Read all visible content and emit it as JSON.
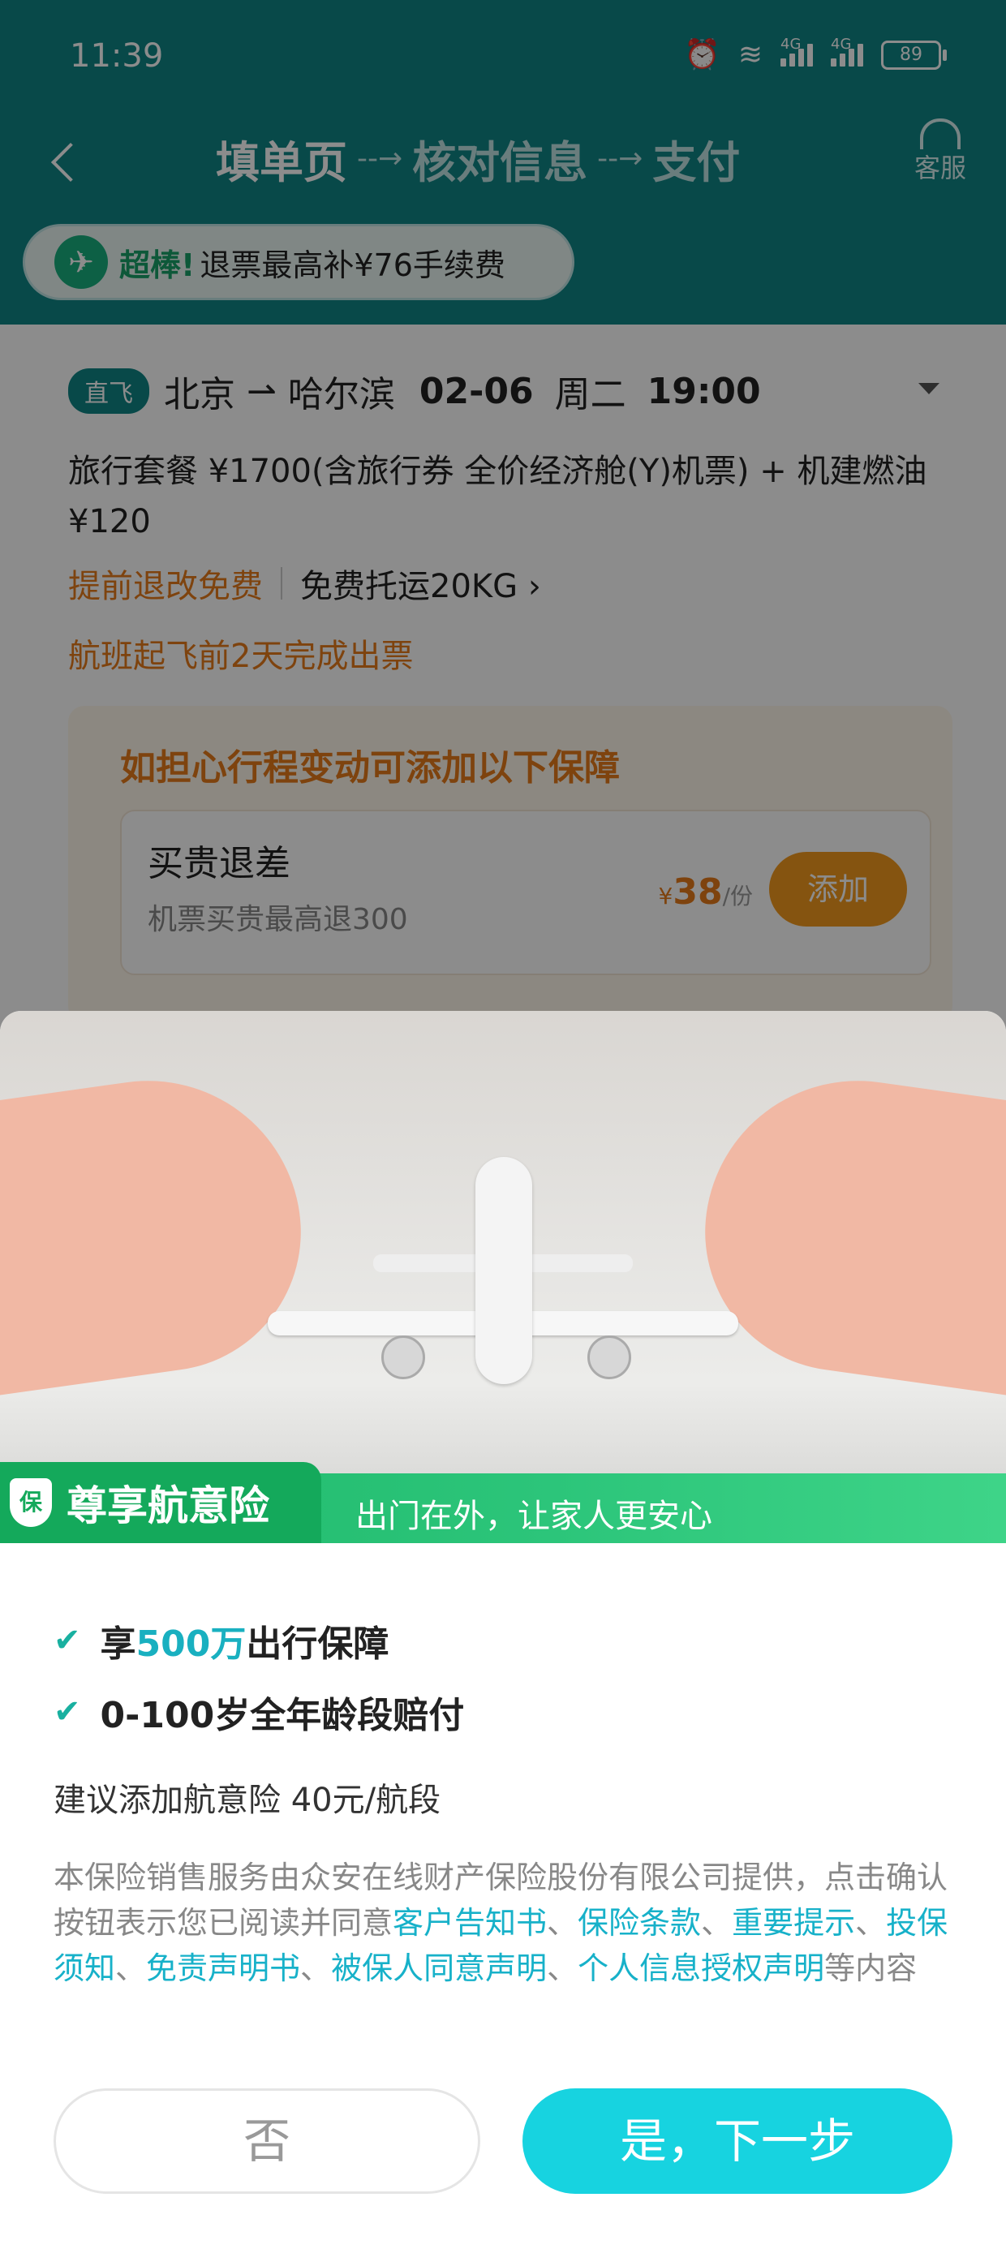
{
  "status_bar": {
    "time": "11:39",
    "battery": "89",
    "network_label": "4G"
  },
  "nav": {
    "steps": [
      "填单页",
      "核对信息",
      "支付"
    ],
    "service_label": "客服"
  },
  "promo": {
    "strong": "超棒!",
    "text": "退票最高补¥76手续费"
  },
  "flight": {
    "badge": "直飞",
    "from": "北京",
    "to": "哈尔滨",
    "date": "02-06",
    "weekday": "周二",
    "time": "19:00",
    "fare_line": "旅行套餐 ¥1700(含旅行券 全价经济舱(Y)机票) + 机建燃油 ¥120",
    "refund_rule": "提前退改免费",
    "baggage": "免费托运20KG ›",
    "ticketing": "航班起飞前2天完成出票"
  },
  "guarantee": {
    "title": "如担心行程变动可添加以下保障",
    "item_name": "买贵退差",
    "item_desc": "机票买贵最高退300",
    "currency": "¥",
    "price": "38",
    "unit": "/份",
    "add_label": "添加"
  },
  "insurance": {
    "badge_title": "尊享航意险",
    "slogan": "出门在外，让家人更安心",
    "benefit1_pre": "享",
    "benefit1_hl": "500万",
    "benefit1_post": "出行保障",
    "benefit2": "0-100岁全年龄段赔付",
    "suggest": "建议添加航意险 40元/航段",
    "legal_pre": "本保险销售服务由众安在线财产保险股份有限公司提供，点击确认按钮表示您已阅读并同意",
    "links": [
      "客户告知书",
      "保险条款",
      "重要提示",
      "投保须知",
      "免责声明书",
      "被保人同意声明",
      "个人信息授权声明"
    ],
    "legal_post": "等内容",
    "no_label": "否",
    "yes_label": "是，下一步"
  },
  "colors": {
    "teal_header": "#0f8585",
    "accent_cyan": "#17d3e0",
    "orange": "#e67a1a",
    "green": "#14a95b"
  }
}
